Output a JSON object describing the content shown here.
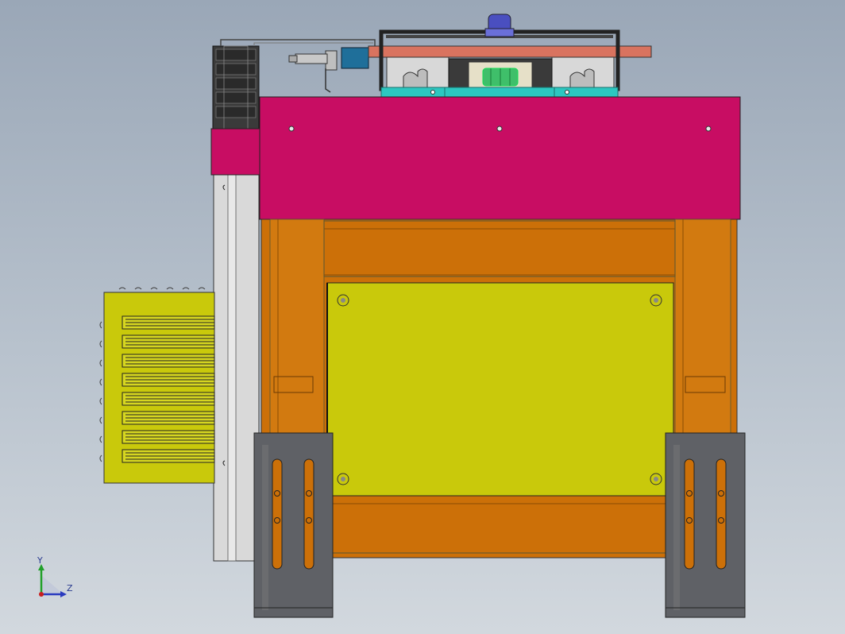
{
  "viewport": {
    "background_top": "#9aa7b7",
    "background_bottom": "#d2d8de"
  },
  "colors": {
    "magenta_plate": "#c80d63",
    "orange_frame": "#cc7008",
    "yellow_panel": "#c9c90b",
    "grey_feet": "#5f6166",
    "cyan_plate": "#2cc7c0",
    "salmon_bar": "#d9735f",
    "rail_grey": "#d8d8d8",
    "motor_blue": "#4a4fc0",
    "chain_dark": "#2c2c2c",
    "teal_bracket": "#1f6f9a"
  },
  "triad": {
    "y_label": "Y",
    "z_label": "Z",
    "icon": "coordinate-triad-icon"
  }
}
